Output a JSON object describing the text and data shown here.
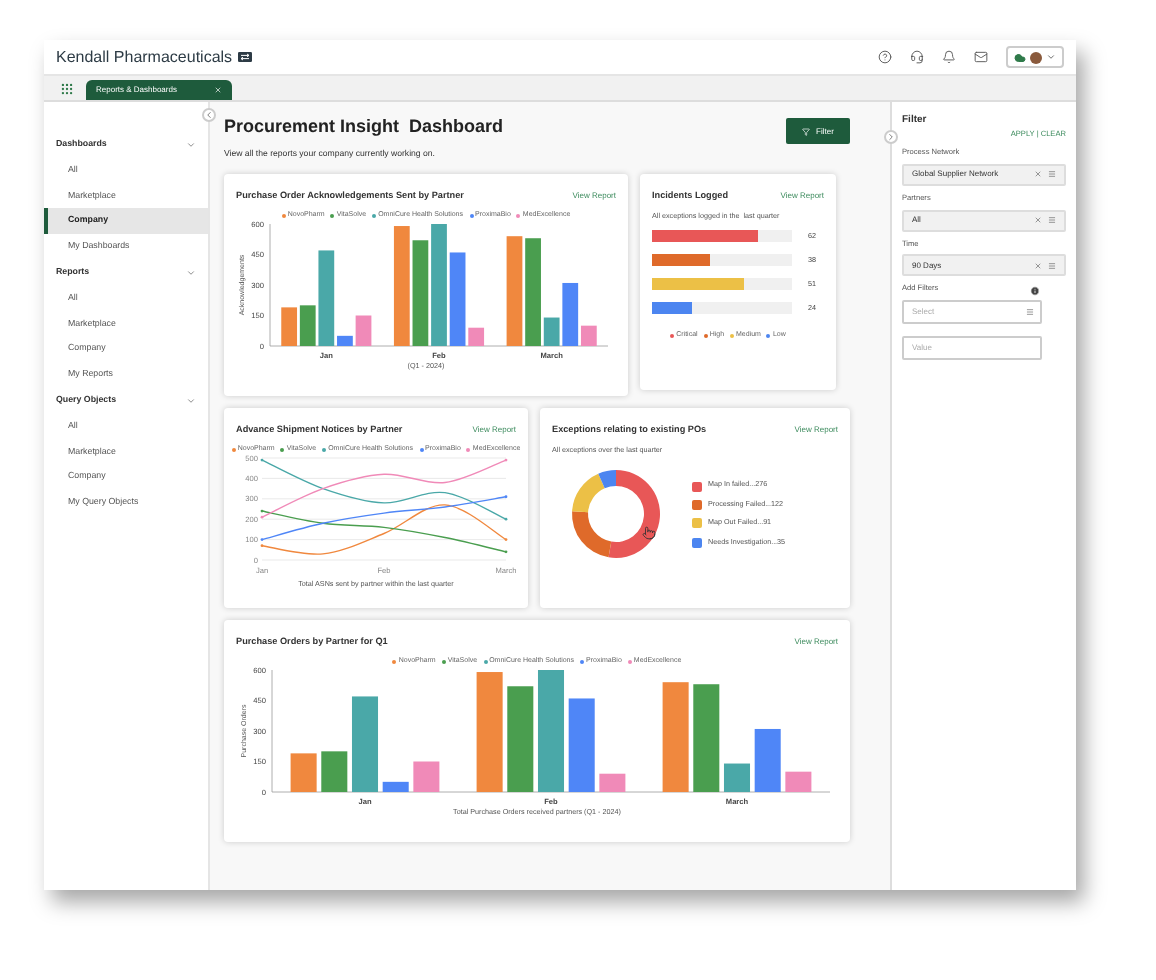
{
  "header": {
    "company": "Kendall Pharmaceuticals"
  },
  "tabs": [
    {
      "label": "Reports & Dashboards",
      "selected": true
    }
  ],
  "sidebar": {
    "sections": [
      {
        "title": "Dashboards",
        "expanded": true,
        "items": [
          {
            "label": "All",
            "selected": false
          },
          {
            "label": "Marketplace",
            "selected": false
          },
          {
            "label": "Company",
            "selected": true
          },
          {
            "label": "My Dashboards",
            "selected": false
          }
        ]
      },
      {
        "title": "Reports",
        "expanded": true,
        "items": [
          {
            "label": "All",
            "selected": false
          },
          {
            "label": "Marketplace",
            "selected": false
          },
          {
            "label": "Company",
            "selected": false
          },
          {
            "label": "My Reports",
            "selected": false
          }
        ]
      },
      {
        "title": "Query Objects",
        "expanded": true,
        "items": [
          {
            "label": "All",
            "selected": false
          },
          {
            "label": "Marketplace",
            "selected": false
          },
          {
            "label": "Company",
            "selected": false
          },
          {
            "label": "My Query Objects",
            "selected": false
          }
        ]
      }
    ]
  },
  "page": {
    "title": "Procurement Insight  Dashboard",
    "subtitle": "View all the reports your company currently working on.",
    "filter_button": "Filter"
  },
  "cards": [
    {
      "kind": "chart",
      "title": "Purchase Order Acknowledgements Sent by Partner",
      "link": "View Report",
      "chart_data": {
        "type": "bar",
        "xlabel": "(Q1 - 2024)",
        "ylabel": "Acknowledgements",
        "categories": [
          "Jan",
          "Feb",
          "March"
        ],
        "ylim": [
          0,
          600
        ],
        "yticks": [
          0,
          150,
          300,
          450,
          600
        ],
        "series": [
          {
            "name": "NovoPharm",
            "color": "#f0883e",
            "values": [
              190,
              590,
              540
            ]
          },
          {
            "name": "VitaSolve",
            "color": "#4a9e4f",
            "values": [
              200,
              520,
              530
            ]
          },
          {
            "name": "OmniCure Health Solutions",
            "color": "#4aa8a8",
            "values": [
              470,
              600,
              140
            ]
          },
          {
            "name": "ProximaBio",
            "color": "#4f86f7",
            "values": [
              50,
              460,
              310
            ]
          },
          {
            "name": "MedExcellence",
            "color": "#f08ab8",
            "values": [
              150,
              90,
              100
            ]
          }
        ]
      }
    },
    {
      "kind": "meters",
      "title": "Incidents Logged",
      "link": "View Report",
      "subtitle": "All exceptions logged in the  last quarter",
      "meters": [
        {
          "level": 0.76,
          "reading": "62",
          "color": "#e85757"
        },
        {
          "level": 0.42,
          "reading": "38",
          "color": "#df6a2a"
        },
        {
          "level": 0.65,
          "reading": "51",
          "color": "#ecc046"
        },
        {
          "level": 0.28,
          "reading": "24",
          "color": "#4c85f0"
        }
      ],
      "legend": [
        {
          "label": "Critical",
          "color": "#e85757"
        },
        {
          "label": "High",
          "color": "#df6a2a"
        },
        {
          "label": "Medium",
          "color": "#ecc046"
        },
        {
          "label": "Low",
          "color": "#4c85f0"
        }
      ]
    },
    {
      "kind": "chart",
      "title": "Advance Shipment Notices by Partner",
      "link": "View Report",
      "chart_data": {
        "type": "line",
        "xlabel": "Total ASNs sent by partner within the last quarter",
        "categories": [
          "Jan",
          null,
          "Feb",
          null,
          "March"
        ],
        "grid": true,
        "ylim": [
          0,
          500
        ],
        "yticks": [
          0,
          100,
          200,
          300,
          400,
          500
        ],
        "series": [
          {
            "name": "NovoPharm",
            "color": "#f0883e",
            "values": [
              70,
              30,
              130,
              270,
              100
            ]
          },
          {
            "name": "VitaSolve",
            "color": "#4a9e4f",
            "values": [
              240,
              180,
              160,
              110,
              40
            ]
          },
          {
            "name": "OmniCure Health Solutions",
            "color": "#4aa8a8",
            "values": [
              490,
              350,
              280,
              330,
              200
            ]
          },
          {
            "name": "ProximaBio",
            "color": "#4f86f7",
            "values": [
              100,
              180,
              230,
              260,
              310
            ]
          },
          {
            "name": "MedExcellence",
            "color": "#f08ab8",
            "values": [
              210,
              350,
              420,
              380,
              490
            ]
          }
        ]
      }
    },
    {
      "kind": "chart",
      "title": "Exceptions relating to existing POs",
      "link": "View Report",
      "subtitle": "All exceptions over the last quarter",
      "chart_data": {
        "type": "donut",
        "categories": [
          "Map In failed...276",
          "Processing Failed...122",
          "Map Out Failed...91",
          "Needs Investigation...35"
        ],
        "values": [
          52.7,
          23.3,
          17.4,
          6.6
        ],
        "colors": [
          "#e85757",
          "#df6a2a",
          "#ecc046",
          "#4c85f0"
        ]
      }
    },
    {
      "kind": "chart",
      "title": "Purchase Orders by Partner for Q1",
      "link": "View Report",
      "chart_data": {
        "type": "bar",
        "xlabel": "Total Purchase Orders received partners (Q1 - 2024)",
        "ylabel": "Purchase Orders",
        "categories": [
          "Jan",
          "Feb",
          "March"
        ],
        "ylim": [
          0,
          600
        ],
        "yticks": [
          0,
          150,
          300,
          450,
          600
        ],
        "series": [
          {
            "name": "NovoPharm",
            "color": "#f0883e",
            "values": [
              190,
              590,
              540
            ]
          },
          {
            "name": "VitaSolve",
            "color": "#4a9e4f",
            "values": [
              200,
              520,
              530
            ]
          },
          {
            "name": "OmniCure Health Solutions",
            "color": "#4aa8a8",
            "values": [
              470,
              600,
              140
            ]
          },
          {
            "name": "ProximaBio",
            "color": "#4f86f7",
            "values": [
              50,
              460,
              310
            ]
          },
          {
            "name": "MedExcellence",
            "color": "#f08ab8",
            "values": [
              150,
              90,
              100
            ]
          }
        ]
      }
    }
  ],
  "filter_panel": {
    "title": "Filter",
    "apply": "APPLY",
    "separator": "|",
    "clear": "CLEAR",
    "fields": [
      {
        "label": "Process Network",
        "value": "Global Supplier Network"
      },
      {
        "label": "Partners",
        "value": "All"
      },
      {
        "label": "Time",
        "value": "90 Days"
      }
    ],
    "add_filters": {
      "label": "Add Filters",
      "select_placeholder": "Select",
      "value_placeholder": "Value"
    }
  }
}
